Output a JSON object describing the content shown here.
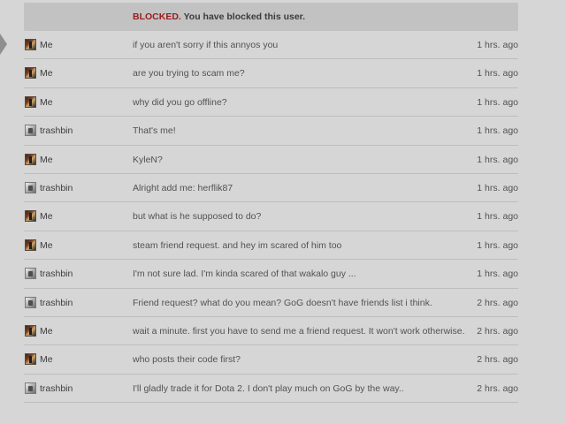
{
  "banner": {
    "status_word": "BLOCKED.",
    "status_text": "You have blocked this user."
  },
  "messages": [
    {
      "sender": "Me",
      "avatar": "me-avatar",
      "text": "if you aren't sorry if this annyos you",
      "time": "1 hrs. ago"
    },
    {
      "sender": "Me",
      "avatar": "me-avatar",
      "text": "are you trying to scam me?",
      "time": "1 hrs. ago"
    },
    {
      "sender": "Me",
      "avatar": "me-avatar",
      "text": "why did you go offline?",
      "time": "1 hrs. ago"
    },
    {
      "sender": "trashbin",
      "avatar": "trashbin-avatar",
      "text": "That's me!",
      "time": "1 hrs. ago"
    },
    {
      "sender": "Me",
      "avatar": "me-avatar",
      "text": "KyleN?",
      "time": "1 hrs. ago"
    },
    {
      "sender": "trashbin",
      "avatar": "trashbin-avatar",
      "text": "Alright add me: herflik87",
      "time": "1 hrs. ago"
    },
    {
      "sender": "Me",
      "avatar": "me-avatar",
      "text": "but what is he supposed to do?",
      "time": "1 hrs. ago"
    },
    {
      "sender": "Me",
      "avatar": "me-avatar",
      "text": "steam friend request. and hey im scared of him too",
      "time": "1 hrs. ago"
    },
    {
      "sender": "trashbin",
      "avatar": "trashbin-avatar",
      "text": "I'm not sure lad. I'm kinda scared of that wakalo guy ...",
      "time": "1 hrs. ago"
    },
    {
      "sender": "trashbin",
      "avatar": "trashbin-avatar",
      "text": "Friend request? what do you mean? GoG doesn't have friends list i think.",
      "time": "2 hrs. ago"
    },
    {
      "sender": "Me",
      "avatar": "me-avatar",
      "text": "wait a minute. first you have to send me a friend request. It won't work otherwise.",
      "time": "2 hrs. ago"
    },
    {
      "sender": "Me",
      "avatar": "me-avatar",
      "text": "who posts their code first?",
      "time": "2 hrs. ago"
    },
    {
      "sender": "trashbin",
      "avatar": "trashbin-avatar",
      "text": "I'll gladly trade it for Dota 2. I don't play much on GoG by the way..",
      "time": "2 hrs. ago"
    }
  ]
}
